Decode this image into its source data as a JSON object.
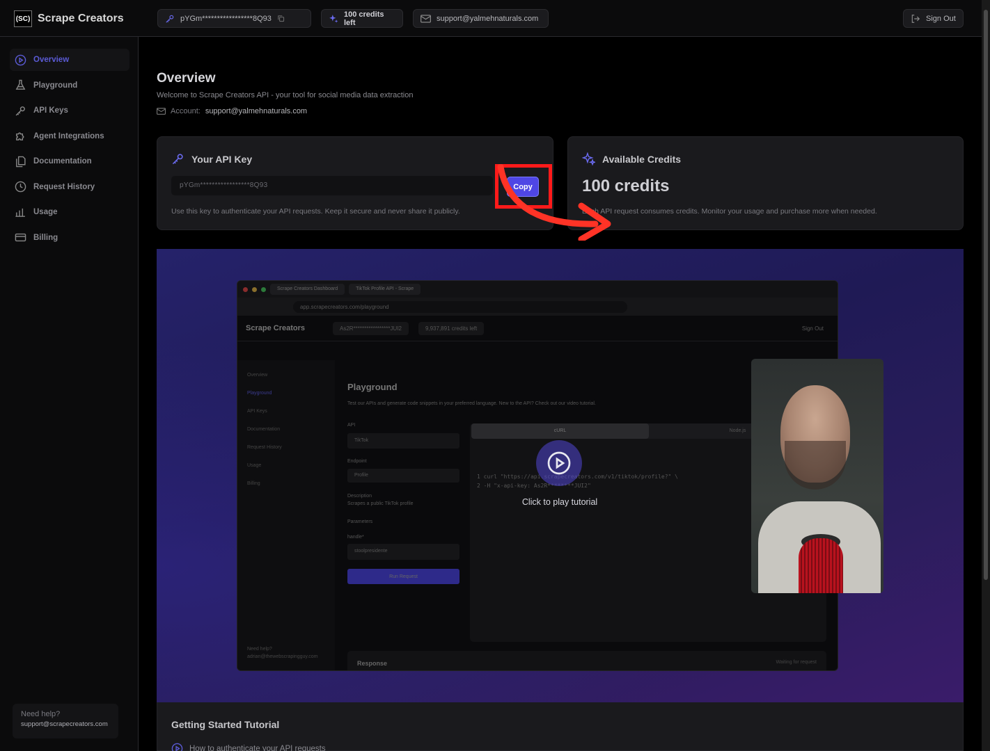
{
  "app": {
    "logo_mark": "(SC)",
    "name": "Scrape Creators"
  },
  "topbar": {
    "api_key_masked": "pYGm*****************8Q93",
    "credits_label": "100 credits left",
    "email": "support@yalmehnaturals.com",
    "sign_out_label": "Sign Out"
  },
  "sidebar": {
    "items": [
      {
        "label": "Overview",
        "icon": "play-circle-icon",
        "active": true
      },
      {
        "label": "Playground",
        "icon": "flask-icon"
      },
      {
        "label": "API Keys",
        "icon": "key-icon"
      },
      {
        "label": "Agent Integrations",
        "icon": "puzzle-icon"
      },
      {
        "label": "Documentation",
        "icon": "document-icon"
      },
      {
        "label": "Request History",
        "icon": "clock-icon"
      },
      {
        "label": "Usage",
        "icon": "bar-chart-icon"
      },
      {
        "label": "Billing",
        "icon": "credit-card-icon"
      }
    ],
    "help": {
      "title": "Need help?",
      "email": "support@scrapecreators.com"
    }
  },
  "main": {
    "title": "Overview",
    "subtitle": "Welcome to Scrape Creators API - your tool for social media data extraction",
    "account_label": "Account:",
    "account_email": "support@yalmehnaturals.com",
    "api_card": {
      "title": "Your API Key",
      "key_masked": "pYGm*****************8Q93",
      "copy_label": "Copy",
      "note": "Use this key to authenticate your API requests. Keep it secure and never share it publicly."
    },
    "credits_card": {
      "title": "Available Credits",
      "value": "100 credits",
      "note": "Each API request consumes credits. Monitor your usage and purchase more when needed."
    },
    "video": {
      "play_label": "Click to play tutorial",
      "browser": {
        "tab1": "Scrape Creators Dashboard",
        "tab2": "TikTok Profile API - Scrape",
        "url": "app.scrapecreators.com/playground",
        "logo": "Scrape Creators",
        "key_chip": "As2R*****************JUI2",
        "credits_chip": "9,937,891 credits left",
        "sign_out": "Sign Out",
        "side_items": [
          "Overview",
          "Playground",
          "API Keys",
          "Documentation",
          "Request History",
          "Usage",
          "Billing"
        ],
        "side_help_1": "Need help?",
        "side_help_2": "adrian@thewebscrapingguy.com",
        "heading": "Playground",
        "desc": "Test our APIs and generate code snippets in your preferred language. New to the API? Check out our video tutorial.",
        "api_label": "API",
        "api_value": "TikTok",
        "endpoint_label": "Endpoint",
        "endpoint_value": "Profile",
        "description_label": "Description",
        "description_value": "Scrapes a public TikTok profile",
        "parameters_label": "Parameters",
        "handle_label": "handle*",
        "handle_value": "stoolpresidente",
        "run_label": "Run Request",
        "tab_curl": "cURL",
        "tab_node": "Node.js",
        "code_line1": "1  curl \"https://api.scrapecreators.com/v1/tiktok/profile?\" \\",
        "code_line2": "2    -H \"x-api-key: As2R********JUI2\"",
        "response_label": "Response",
        "waiting_label": "Waiting for request"
      }
    },
    "tutorial": {
      "title": "Getting Started Tutorial",
      "first_item": "How to authenticate your API requests"
    }
  }
}
